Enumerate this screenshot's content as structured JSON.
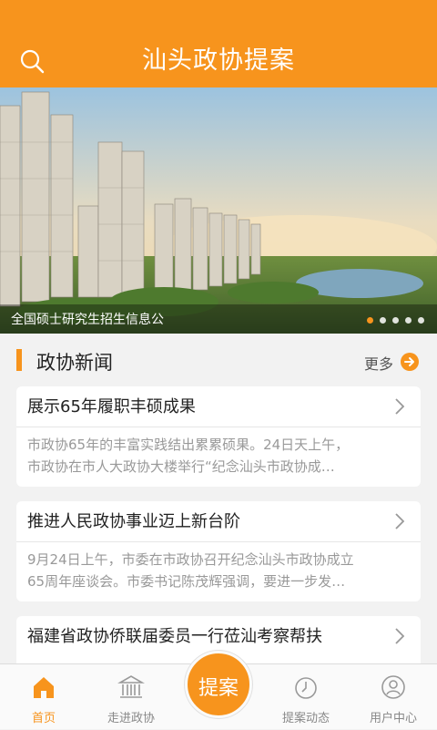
{
  "app": {
    "title": "汕头政协提案"
  },
  "icons": {
    "search": "search-icon",
    "more": "arrow-right-circle-icon",
    "chevron": "chevron-right-icon"
  },
  "colors": {
    "accent": "#f7941d"
  },
  "banner": {
    "caption": "全国硕士研究生招生信息公",
    "slide_count": 5,
    "active_slide": 1
  },
  "news_section": {
    "title": "政协新闻",
    "more_label": "更多",
    "items": [
      {
        "title": "展示65年履职丰硕成果",
        "summary_line1": "市政协65年的丰富实践结出累累硕果。24日天上午，",
        "summary_line2": "市政协在市人大政协大楼举行“纪念汕头市政协成…"
      },
      {
        "title": "推进人民政协事业迈上新台阶",
        "summary_line1": "9月24日上午，市委在市政协召开纪念汕头市政协成立",
        "summary_line2": "65周年座谈会。市委书记陈茂辉强调，要进一步发…"
      },
      {
        "title": "福建省政协侨联届委员一行莅汕考察帮扶"
      }
    ]
  },
  "tabbar": {
    "home": "首页",
    "about": "走进政协",
    "proposal": "提案",
    "dynamics": "提案动态",
    "user": "用户中心"
  }
}
